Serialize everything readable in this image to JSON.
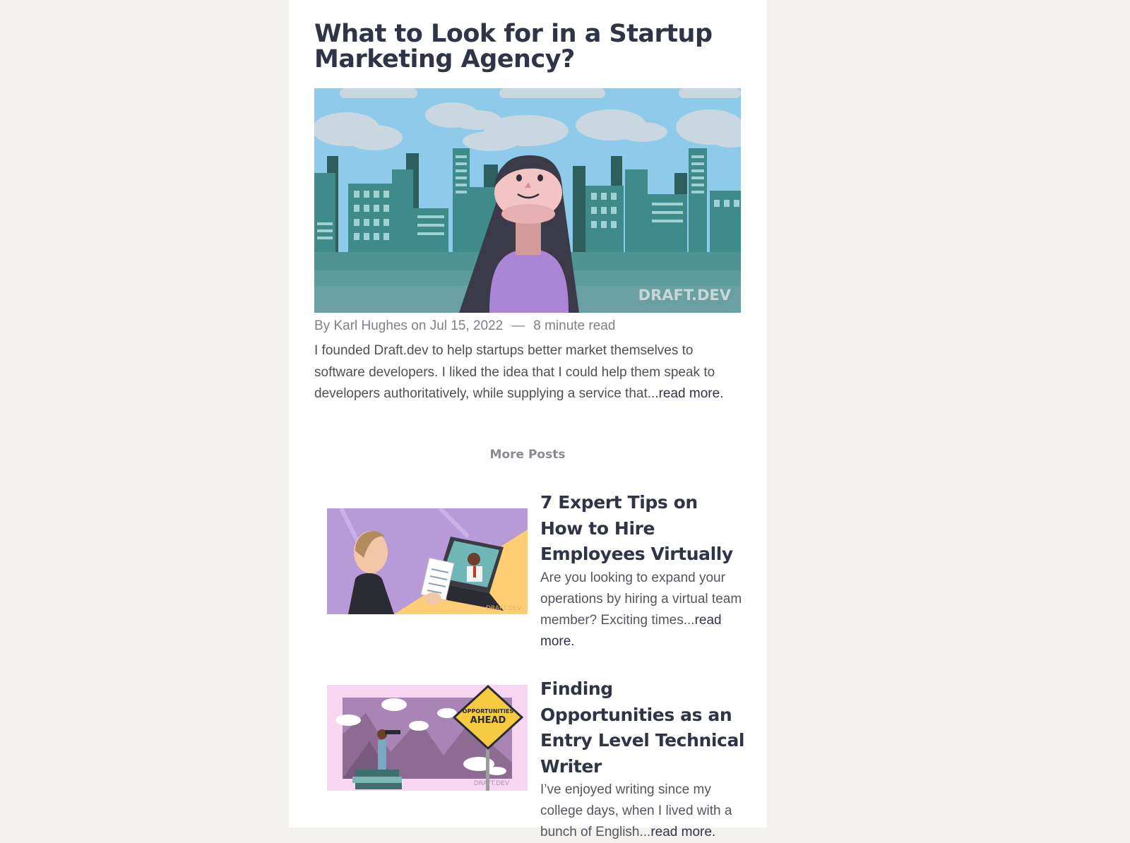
{
  "post": {
    "title": "What to Look for in a Startup Marketing Agency?",
    "hero_watermark": "DRAFT.DEV",
    "meta": {
      "by": "By Karl Hughes on Jul 15, 2022",
      "separator": "—",
      "read_time": "8 minute read"
    },
    "excerpt": "I founded Draft.dev to help startups better market themselves to software developers. I liked the idea that I could help them speak to developers authoritatively, while supplying a service that...",
    "read_more": "read more."
  },
  "more_posts": {
    "heading": "More Posts",
    "items": [
      {
        "title": "7 Expert Tips on How to Hire Employees Virtually",
        "excerpt": "Are you looking to expand your operations by hiring a virtual team member? Exciting times...",
        "read_more": "read more.",
        "thumb_watermark": "DRAFT.DEV"
      },
      {
        "title": "Finding Opportunities as an Entry Level Technical Writer",
        "excerpt": "I’ve enjoyed writing since my college days, when I lived with a bunch of English...",
        "read_more": "read more.",
        "thumb_sign_line1": "OPPORTUNITIES",
        "thumb_sign_line2": "AHEAD",
        "thumb_watermark": "DRAFT.DEV"
      }
    ]
  },
  "colors": {
    "page_bg": "#f3f2ef",
    "card_bg": "#ffffff",
    "heading": "#2f3447",
    "body_text": "#4f4f58",
    "muted": "#808088",
    "sky": "#8ecbeb",
    "building_teal": "#3f8a8a",
    "purple": "#ab86d6"
  }
}
